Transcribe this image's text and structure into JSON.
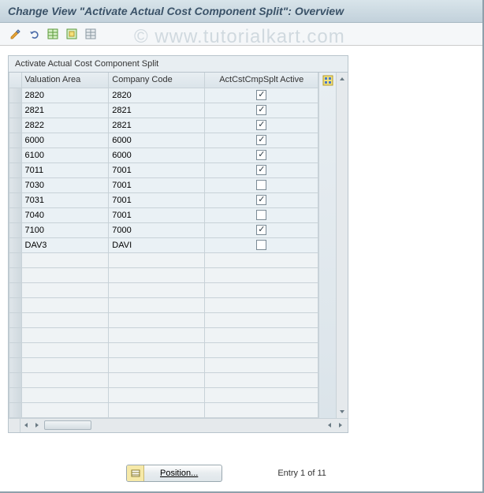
{
  "title": "Change View \"Activate Actual Cost Component Split\": Overview",
  "watermark": "© www.tutorialkart.com",
  "panel": {
    "title": "Activate Actual Cost Component Split",
    "columns": {
      "valuation_area": "Valuation Area",
      "company_code": "Company Code",
      "active": "ActCstCmpSplt Active"
    },
    "rows": [
      {
        "valuation_area": "2820",
        "company_code": "2820",
        "active": true
      },
      {
        "valuation_area": "2821",
        "company_code": "2821",
        "active": true
      },
      {
        "valuation_area": "2822",
        "company_code": "2821",
        "active": true
      },
      {
        "valuation_area": "6000",
        "company_code": "6000",
        "active": true
      },
      {
        "valuation_area": "6100",
        "company_code": "6000",
        "active": true
      },
      {
        "valuation_area": "7011",
        "company_code": "7001",
        "active": true
      },
      {
        "valuation_area": "7030",
        "company_code": "7001",
        "active": false
      },
      {
        "valuation_area": "7031",
        "company_code": "7001",
        "active": true
      },
      {
        "valuation_area": "7040",
        "company_code": "7001",
        "active": false
      },
      {
        "valuation_area": "7100",
        "company_code": "7000",
        "active": true
      },
      {
        "valuation_area": "DAV3",
        "company_code": "DAVI",
        "active": false
      }
    ],
    "empty_rows": 11
  },
  "footer": {
    "position_label": "Position...",
    "entry_text": "Entry 1 of 11"
  },
  "toolbar_icons": [
    "pencil",
    "undo",
    "table-green",
    "table-save",
    "table-grid"
  ]
}
